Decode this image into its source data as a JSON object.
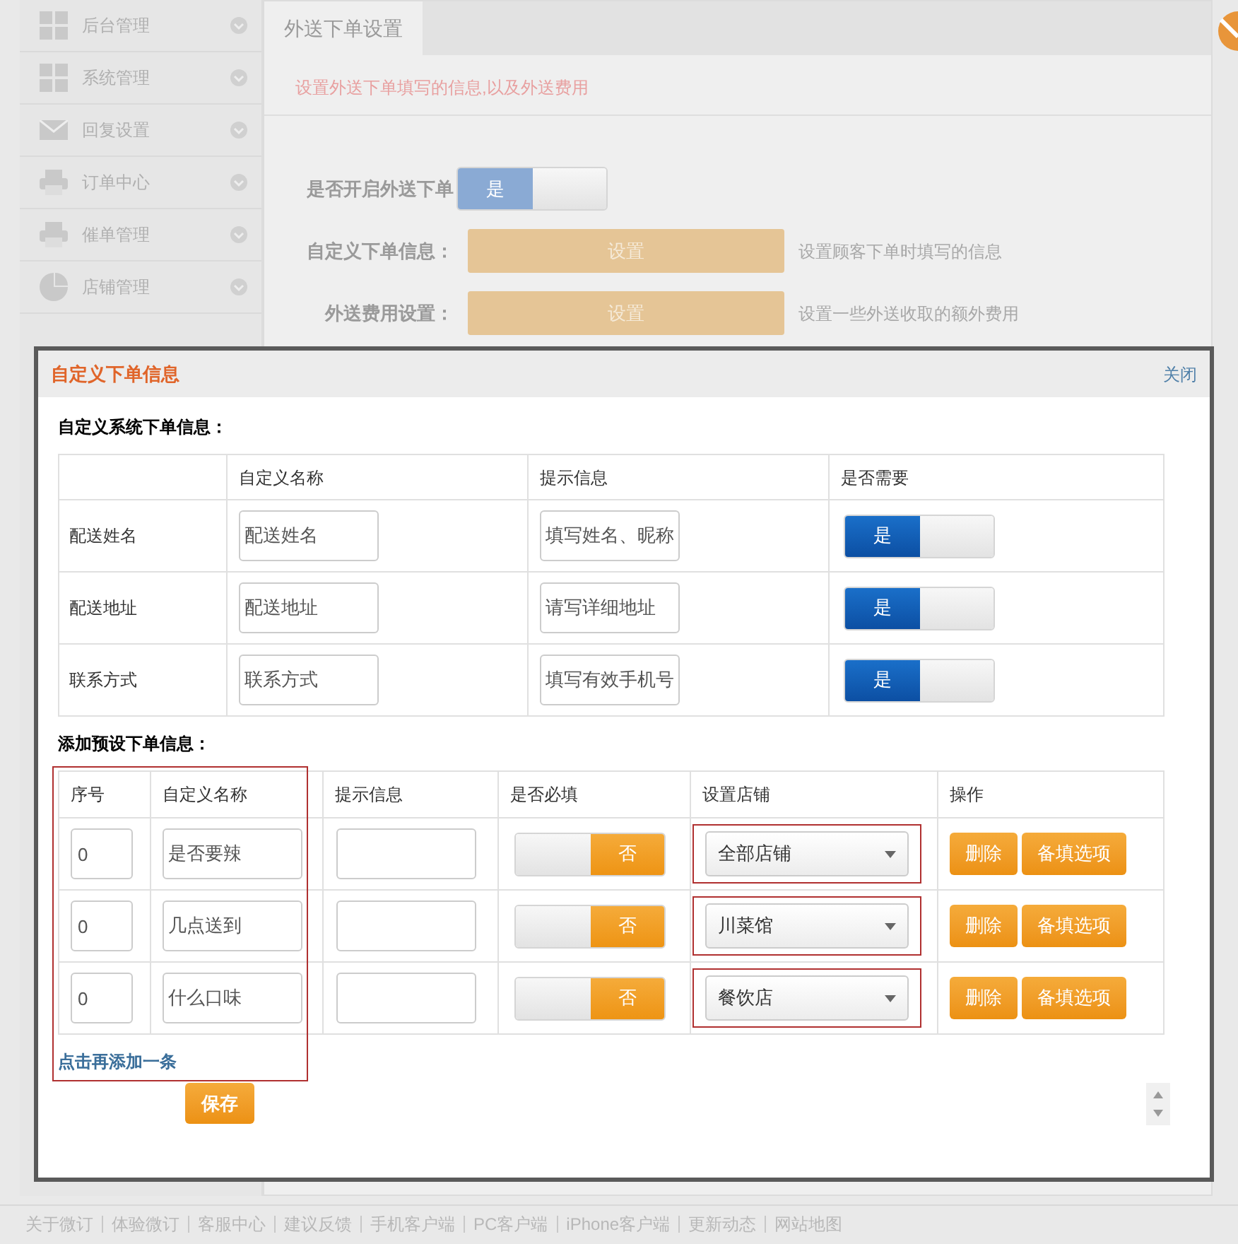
{
  "sidebar": {
    "items": [
      {
        "label": "后台管理"
      },
      {
        "label": "系统管理"
      },
      {
        "label": "回复设置"
      },
      {
        "label": "订单中心"
      },
      {
        "label": "催单管理"
      },
      {
        "label": "店铺管理"
      }
    ]
  },
  "tabs": [
    {
      "label": "外送下单设置",
      "selected": true
    }
  ],
  "hint": "设置外送下单填写的信息,以及外送费用",
  "form": {
    "rows": [
      {
        "kind": "toggle",
        "label": "是否开启外送下单",
        "on": true,
        "toggle_text": "是"
      },
      {
        "kind": "button",
        "label": "自定义下单信息：",
        "button": "设置",
        "note": "设置顾客下单时填写的信息"
      },
      {
        "kind": "button",
        "label": "外送费用设置：",
        "button": "设置",
        "note": "设置一些外送收取的额外费用"
      }
    ]
  },
  "dialog": {
    "title": "自定义下单信息",
    "close": "关闭",
    "system_section": {
      "title": "自定义系统下单信息：",
      "columns": [
        "自定义名称",
        "提示信息",
        "是否需要"
      ],
      "rows": [
        {
          "field": "配送姓名",
          "name": "配送姓名",
          "hint_field": {
            "value": "填写姓名、昵称"
          },
          "required": true,
          "toggle_text": "是"
        },
        {
          "field": "配送地址",
          "name": "配送地址",
          "hint_field": {
            "value": "请写详细地址"
          },
          "required": true,
          "toggle_text": "是"
        },
        {
          "field": "联系方式",
          "name": "联系方式",
          "hint_field": {
            "value": "填写有效手机号"
          },
          "required": true,
          "toggle_text": "是"
        }
      ]
    },
    "preset_section": {
      "title": "添加预设下单信息：",
      "columns": [
        "序号",
        "自定义名称",
        "提示信息",
        "是否必填",
        "设置店铺",
        "操作"
      ],
      "rows": [
        {
          "order": "0",
          "name": "是否要辣",
          "required": false,
          "toggle_text": "否",
          "store": "全部店铺",
          "actions": [
            "删除",
            "备填选项"
          ]
        },
        {
          "order": "0",
          "name": "几点送到",
          "required": false,
          "toggle_text": "否",
          "store": "川菜馆",
          "actions": [
            "删除",
            "备填选项"
          ]
        },
        {
          "order": "0",
          "name": "什么口味",
          "required": false,
          "toggle_text": "否",
          "store": "餐饮店",
          "actions": [
            "删除",
            "备填选项"
          ]
        }
      ],
      "add_link": "点击再添加一条"
    },
    "save": "保存"
  },
  "footer": {
    "links": [
      "关于微订",
      "体验微订",
      "客服中心",
      "建议反馈",
      "手机客户端",
      "PC客户端",
      "iPhone客户端",
      "更新动态",
      "网站地图"
    ]
  }
}
